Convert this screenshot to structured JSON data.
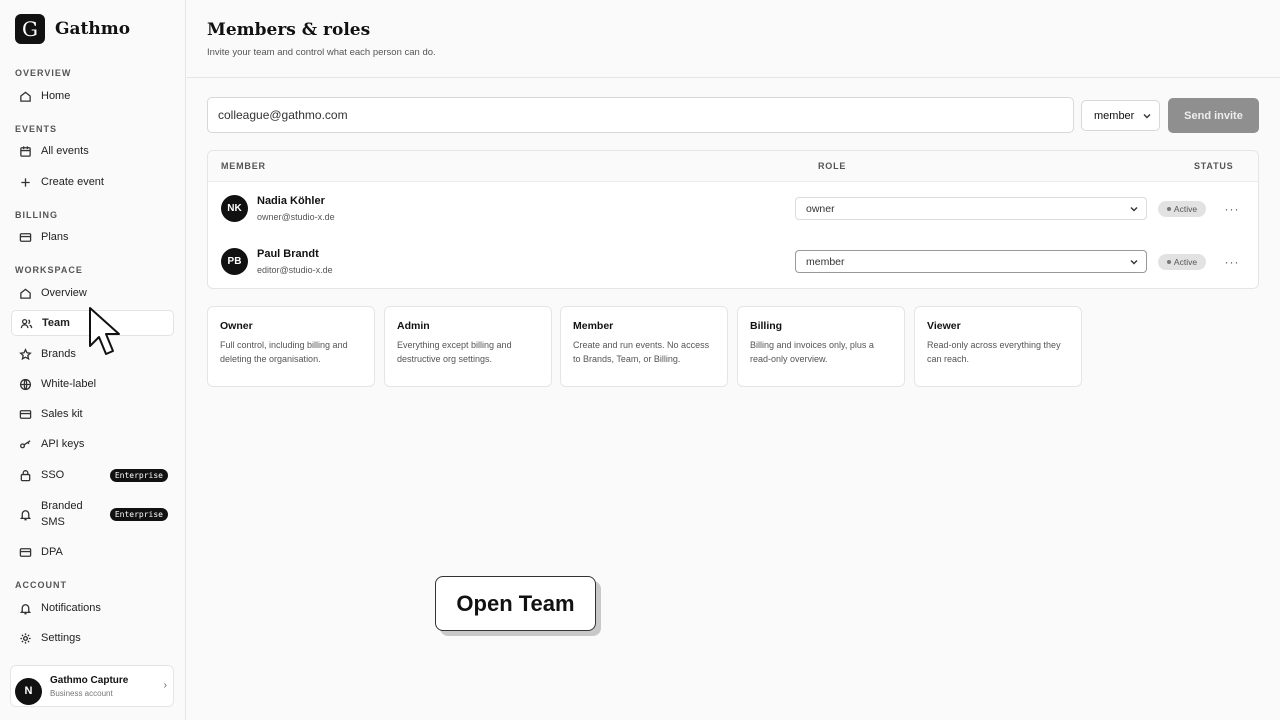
{
  "brand": {
    "logo_letter": "G",
    "name": "Gathmo"
  },
  "sidebar": {
    "sections": {
      "overview": "OVERVIEW",
      "events": "EVENTS",
      "billing": "BILLING",
      "workspace": "WORKSPACE",
      "account": "ACCOUNT"
    },
    "items": {
      "home": "Home",
      "all_events": "All events",
      "create_event": "Create event",
      "plans": "Plans",
      "overview": "Overview",
      "team": "Team",
      "brands": "Brands",
      "white_label": "White-label",
      "sales_kit": "Sales kit",
      "api_keys": "API keys",
      "sso": "SSO",
      "branded_sms": "Branded SMS",
      "dpa": "DPA",
      "notifications": "Notifications",
      "settings": "Settings"
    },
    "enterprise_badge": "Enterprise",
    "account": {
      "avatar_letter": "N",
      "name": "Gathmo Capture",
      "type": "Business account"
    }
  },
  "header": {
    "title": "Members & roles",
    "subtitle": "Invite your team and control what each person can do."
  },
  "invite": {
    "email_value": "colleague@gathmo.com",
    "role_value": "member",
    "send_label": "Send invite"
  },
  "table": {
    "headers": {
      "member": "MEMBER",
      "role": "ROLE",
      "status": "STATUS"
    },
    "rows": [
      {
        "initials": "NK",
        "name": "Nadia Köhler",
        "email": "owner@studio-x.de",
        "role": "owner",
        "status": "Active"
      },
      {
        "initials": "PB",
        "name": "Paul Brandt",
        "email": "editor@studio-x.de",
        "role": "member",
        "status": "Active"
      }
    ],
    "more_glyph": "···"
  },
  "roles": [
    {
      "title": "Owner",
      "desc": "Full control, including billing and deleting the organisation."
    },
    {
      "title": "Admin",
      "desc": "Everything except billing and destructive org settings."
    },
    {
      "title": "Member",
      "desc": "Create and run events. No access to Brands, Team, or Billing."
    },
    {
      "title": "Billing",
      "desc": "Billing and invoices only, plus a read-only overview."
    },
    {
      "title": "Viewer",
      "desc": "Read-only across everything they can reach."
    }
  ],
  "tooltip": {
    "label": "Open Team"
  },
  "colors": {
    "accent": "#111111",
    "send_button_disabled": "#8f8f8f",
    "status_pill": "#e2e2e2"
  }
}
